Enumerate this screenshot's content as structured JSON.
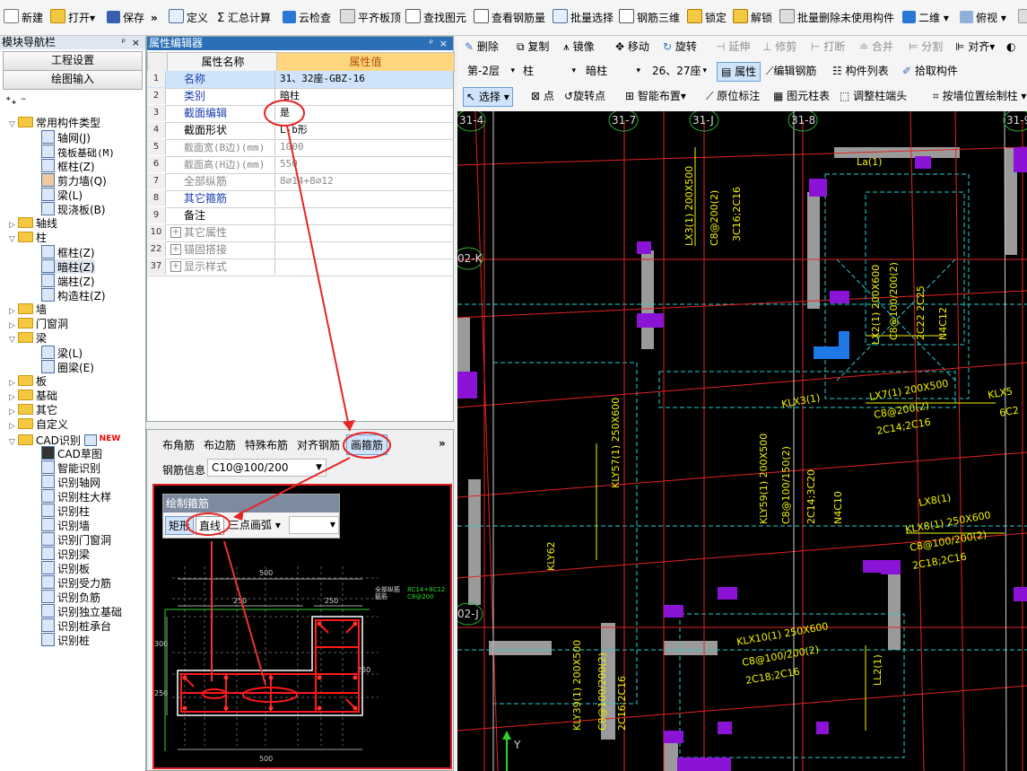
{
  "toolbar": {
    "new": "新建",
    "open": "打开",
    "save": "保存",
    "more": "»",
    "define": "定义",
    "summary": "汇总计算",
    "cloud_check": "云检查",
    "flat_top": "平齐板顶",
    "find_element": "查找图元",
    "view_rebar": "查看钢筋量",
    "batch_select": "批量选择",
    "rebar_3d": "钢筋三维",
    "lock": "锁定",
    "unlock": "解锁",
    "batch_delete": "批量删除未使用构件",
    "view_2d": "二维",
    "view_top": "俯视"
  },
  "nav": {
    "title": "模块导航栏",
    "pin": "ᵖ",
    "close": "×",
    "btn_project": "工程设置",
    "btn_drawing": "绘图输入",
    "tree": {
      "common": "常用构件类型",
      "axis_grid": "轴网(J)",
      "raft": "筏板基础(M)",
      "frame_col": "框柱(Z)",
      "shear_wall": "剪力墙(Q)",
      "beam": "梁(L)",
      "slab": "现浇板(B)",
      "axis": "轴线",
      "column": "柱",
      "col_frame": "框柱(Z)",
      "col_hidden": "暗柱(Z)",
      "col_end": "端柱(Z)",
      "col_struct": "构造柱(Z)",
      "wall": "墙",
      "door_window": "门窗洞",
      "beam_group": "梁",
      "beam_l": "梁(L)",
      "ring_beam": "圈梁(E)",
      "slab_group": "板",
      "foundation": "基础",
      "other": "其它",
      "custom": "自定义",
      "cad": "CAD识别",
      "new_badge": "NEW",
      "cad_draft": "CAD草图",
      "smart_recog": "智能识别",
      "recog_grid": "识别轴网",
      "recog_col_detail": "识别柱大样",
      "recog_col": "识别柱",
      "recog_wall": "识别墙",
      "recog_door": "识别门窗洞",
      "recog_beam": "识别梁",
      "recog_slab": "识别板",
      "recog_stress_rebar": "识别受力筋",
      "recog_neg_rebar": "识别负筋",
      "recog_isolated": "识别独立基础",
      "recog_pile_cap": "识别桩承台",
      "recog_pile": "识别桩"
    }
  },
  "props": {
    "title": "属性编辑器",
    "pin": "ᵖ",
    "close": "×",
    "col_name": "属性名称",
    "col_value": "属性值",
    "rows": [
      {
        "n": "1",
        "k": "名称",
        "v": "31、32座-GBZ-16"
      },
      {
        "n": "2",
        "k": "类别",
        "v": "暗柱"
      },
      {
        "n": "3",
        "k": "截面编辑",
        "v": "是"
      },
      {
        "n": "4",
        "k": "截面形状",
        "v": "L-b形"
      },
      {
        "n": "5",
        "k": "截面宽(B边)(mm)",
        "v": "1000"
      },
      {
        "n": "6",
        "k": "截面高(H边)(mm)",
        "v": "550"
      },
      {
        "n": "7",
        "k": "全部纵筋",
        "v": "8⌀14+8⌀12"
      },
      {
        "n": "8",
        "k": "其它箍筋",
        "v": ""
      },
      {
        "n": "9",
        "k": "备注",
        "v": ""
      },
      {
        "n": "10",
        "k": "其它属性",
        "v": ""
      },
      {
        "n": "22",
        "k": "锚固搭接",
        "v": ""
      },
      {
        "n": "37",
        "k": "显示样式",
        "v": ""
      }
    ]
  },
  "lower": {
    "tabs": [
      "布角筋",
      "布边筋",
      "特殊布筋",
      "对齐钢筋",
      "画箍筋"
    ],
    "more": "»",
    "rebar_info_label": "钢筋信息",
    "rebar_info_value": "C10@100/200",
    "draw_stirrup": {
      "title": "绘制箍筋",
      "rect": "矩形",
      "line": "直线",
      "arc": "三点画弧"
    },
    "dims": {
      "top": "500",
      "d250a": "250",
      "d250b": "250",
      "left300": "300",
      "left250": "250",
      "bottom": "500",
      "right": "250"
    },
    "legend": {
      "l1": "全部纵筋",
      "l2": "箍筋",
      "v1": "8C14+8C12",
      "v2": "C8@200"
    }
  },
  "cad_toolbar": {
    "delete": "删除",
    "copy": "复制",
    "mirror": "镜像",
    "move": "移动",
    "rotate": "旋转",
    "extend": "延伸",
    "trim": "修剪",
    "break": "打断",
    "merge": "合并",
    "split": "分割",
    "align": "对齐",
    "floor": "第-2层",
    "type": "柱",
    "subtype": "暗柱",
    "member": "26、27座",
    "attr": "属性",
    "edit_rebar": "编辑钢筋",
    "member_list": "构件列表",
    "pick_member": "拾取构件",
    "select": "选择",
    "point": "点",
    "rotate_point": "旋转点",
    "smart_layout": "智能布置",
    "origin_mark": "原位标注",
    "elem_table": "图元柱表",
    "adjust_col_end": "调整柱端头",
    "by_wall": "按墙位置绘制柱"
  },
  "cad": {
    "axes_top": [
      "31-4",
      "31-7",
      "31-J",
      "31-8",
      "31-9"
    ],
    "axes_left": [
      "02-K",
      "02-J"
    ],
    "beams": [
      "LX3(1) 200X500",
      "C8@200(2)",
      "3C16;2C16",
      "La(1)",
      "LX2(1) 200X600",
      "C8@100/200(2)",
      "2C22 2C25",
      "N4C12",
      "KLX3(1)",
      "LX7(1) 200X500",
      "C8@200(2)",
      "2C14;2C16",
      "KLX5",
      "6C2",
      "KLY57(1) 250X600",
      "KLY59(1) 200X500",
      "C8@100/150(2)",
      "2C14;3C20",
      "N4C10",
      "LX8(1)",
      "KLX8(1) 250X600",
      "C8@100/200(2)",
      "2C18;2C16",
      "KLY62",
      "KLX10(1) 250X600",
      "C8@100/200(2)",
      "2C18;2C16",
      "LL2(1)",
      "KLY39(1) 200X500",
      "C8@100/200(2)",
      "2C16;2C16"
    ],
    "ucs_y": "Y"
  }
}
